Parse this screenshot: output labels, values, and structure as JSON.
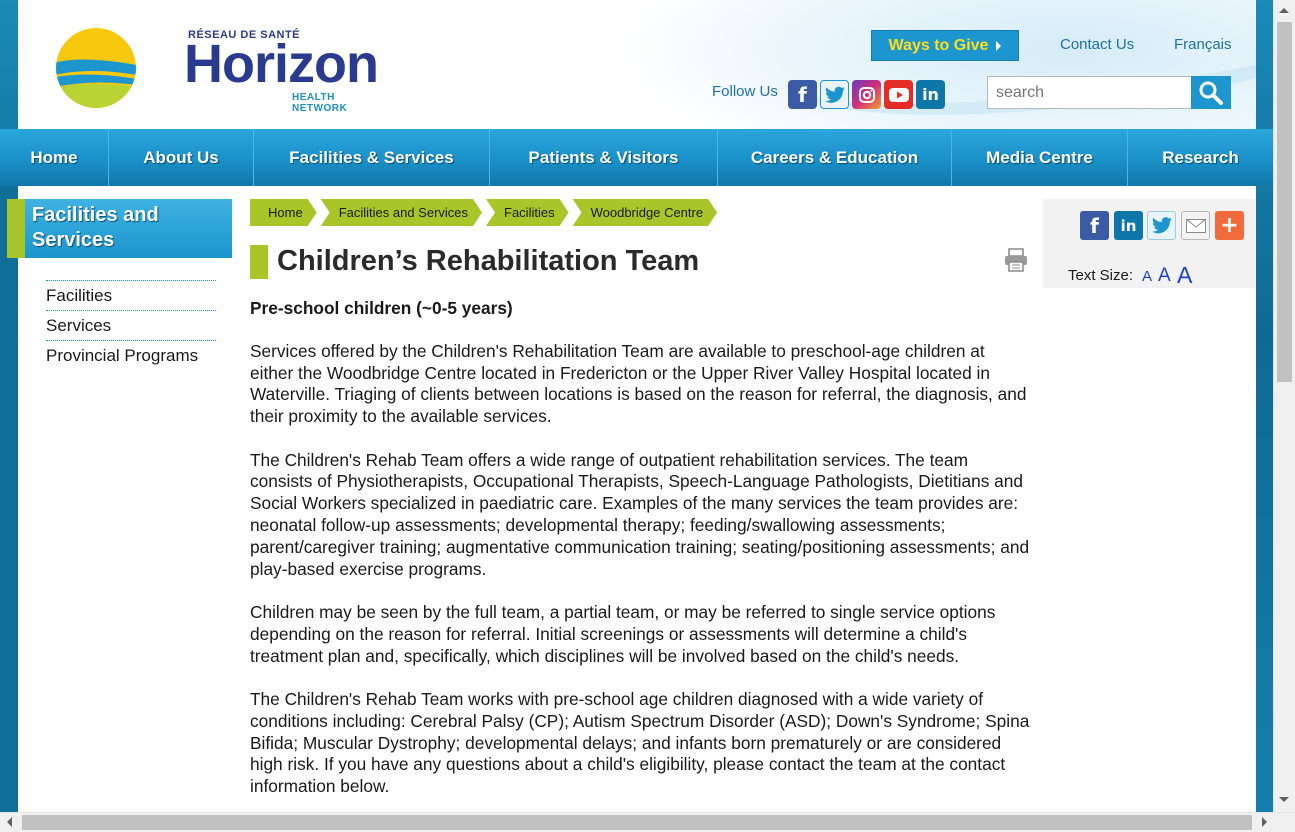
{
  "header": {
    "logo": {
      "top_text": "RÉSEAU DE SANTÉ",
      "main_text": "Horizon",
      "bottom_text": "HEALTH NETWORK"
    },
    "ways_to_give": "Ways to Give",
    "contact_us": "Contact Us",
    "francais": "Français",
    "follow_us": "Follow Us",
    "social_icons": [
      "facebook-icon",
      "twitter-icon",
      "instagram-icon",
      "youtube-icon",
      "linkedin-icon"
    ],
    "search": {
      "placeholder": "search",
      "value": ""
    }
  },
  "nav": {
    "items": [
      {
        "label": "Home"
      },
      {
        "label": "About Us"
      },
      {
        "label": "Facilities & Services"
      },
      {
        "label": "Patients & Visitors"
      },
      {
        "label": "Careers & Education"
      },
      {
        "label": "Media Centre"
      },
      {
        "label": "Research"
      }
    ]
  },
  "sidebar": {
    "heading": "Facilities and Services",
    "items": [
      {
        "label": "Facilities"
      },
      {
        "label": "Services"
      },
      {
        "label": "Provincial Programs"
      }
    ]
  },
  "breadcrumb": [
    {
      "label": "Home"
    },
    {
      "label": "Facilities and Services"
    },
    {
      "label": "Facilities"
    },
    {
      "label": "Woodbridge Centre"
    }
  ],
  "main": {
    "title": "Children’s Rehabilitation Team",
    "subtitle": "Pre-school children (~0-5 years)",
    "paragraphs": [
      "Services offered by the Children's Rehabilitation Team are available to preschool-age children at either the Woodbridge Centre located in Fredericton or the Upper River Valley Hospital located in Waterville. Triaging of clients between locations is based on the reason for referral, the diagnosis, and their proximity to the available services.",
      "The Children's Rehab Team offers a wide range of outpatient rehabilitation services. The team consists of Physiotherapists, Occupational Therapists, Speech-Language Pathologists, Dietitians and Social Workers specialized in paediatric care. Examples of the many services the team provides are: neonatal follow-up assessments; developmental therapy; feeding/swallowing assessments; parent/caregiver training; augmentative communication training; seating/positioning assessments; and play-based exercise programs.",
      "Children may be seen by the full team, a partial team, or may be referred to single service options depending on the reason for referral. Initial screenings or assessments will determine a child's treatment plan and, specifically, which disciplines will be involved based on the child's needs.",
      "The Children's Rehab Team works with pre-school age children diagnosed with a wide variety of conditions including: Cerebral Palsy (CP); Autism Spectrum Disorder (ASD); Down's Syndrome; Spina Bifida; Muscular Dystrophy; developmental delays; and infants born prematurely or are considered high risk. If you have any questions about a child's eligibility, please contact the team at the contact information below."
    ]
  },
  "right_panel": {
    "share_icons": [
      "facebook-share-icon",
      "linkedin-share-icon",
      "twitter-share-icon",
      "email-share-icon",
      "more-share-icon"
    ],
    "text_size_label": "Text Size:",
    "text_sizes": [
      "A",
      "A",
      "A"
    ]
  },
  "colors": {
    "brand_blue": "#1d96cf",
    "brand_green": "#a8c629",
    "nav_blue": "#1a90c8",
    "logo_navy": "#2a3b8f"
  }
}
